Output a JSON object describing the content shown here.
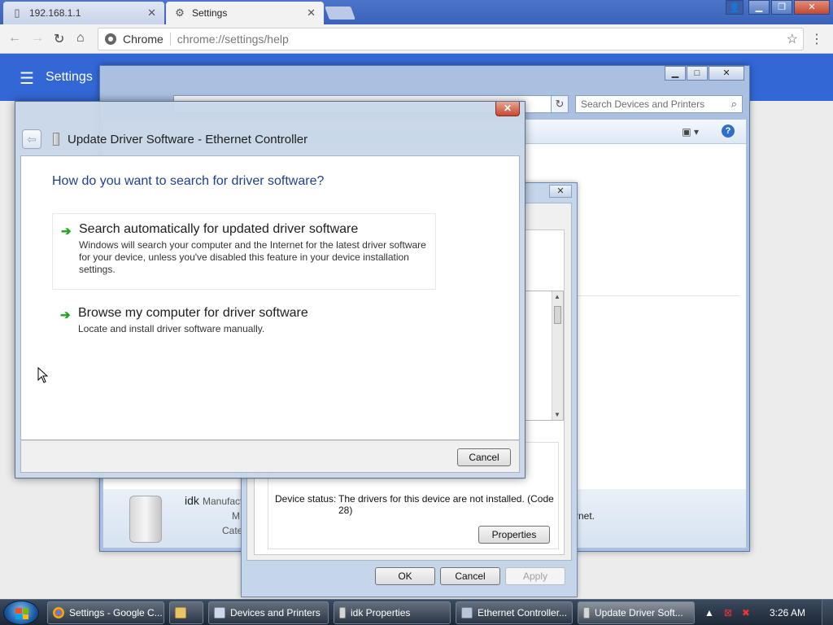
{
  "browser": {
    "tabs": [
      {
        "label": "192.168.1.1",
        "icon": "page-icon"
      },
      {
        "label": "Settings",
        "icon": "gear-icon"
      }
    ],
    "omnibox": {
      "chip": "Chrome",
      "url": "chrome://settings/help"
    }
  },
  "settings": {
    "title": "Settings"
  },
  "devices_window": {
    "search_placeholder": "Search Devices and Printers",
    "device_name": "idk",
    "manufacturer_label": "Manufact",
    "model_label": "M",
    "category_label": "Cate",
    "network_text": "rnet."
  },
  "properties_dialog": {
    "device_status_label": "Device status:",
    "device_status_value": "The drivers for this device are not installed. (Code 28)",
    "properties_button": "Properties",
    "ok_button": "OK",
    "cancel_button": "Cancel",
    "apply_button": "Apply"
  },
  "wizard": {
    "title": "Update Driver Software - Ethernet Controller",
    "question": "How do you want to search for driver software?",
    "options": [
      {
        "title": "Search automatically for updated driver software",
        "description": "Windows will search your computer and the Internet for the latest driver software for your device, unless you've disabled this feature in your device installation settings."
      },
      {
        "title": "Browse my computer for driver software",
        "description": "Locate and install driver software manually."
      }
    ],
    "cancel_button": "Cancel"
  },
  "taskbar": {
    "items": [
      {
        "label": "Settings - Google C...",
        "icon": "chrome-icon",
        "active": false
      },
      {
        "label": "",
        "icon": "folder-icon",
        "active": false
      },
      {
        "label": "Devices and Printers",
        "icon": "devices-icon",
        "active": false
      },
      {
        "label": "idk Properties",
        "icon": "device-icon",
        "active": false
      },
      {
        "label": "Ethernet Controller...",
        "icon": "device-manager-icon",
        "active": false
      },
      {
        "label": "Update Driver Soft...",
        "icon": "driver-icon",
        "active": true
      }
    ],
    "clock": "3:26 AM"
  },
  "colors": {
    "settings_blue": "#3367d6",
    "wizard_heading": "#1f3f92",
    "option_arrow": "#1fa51f"
  }
}
